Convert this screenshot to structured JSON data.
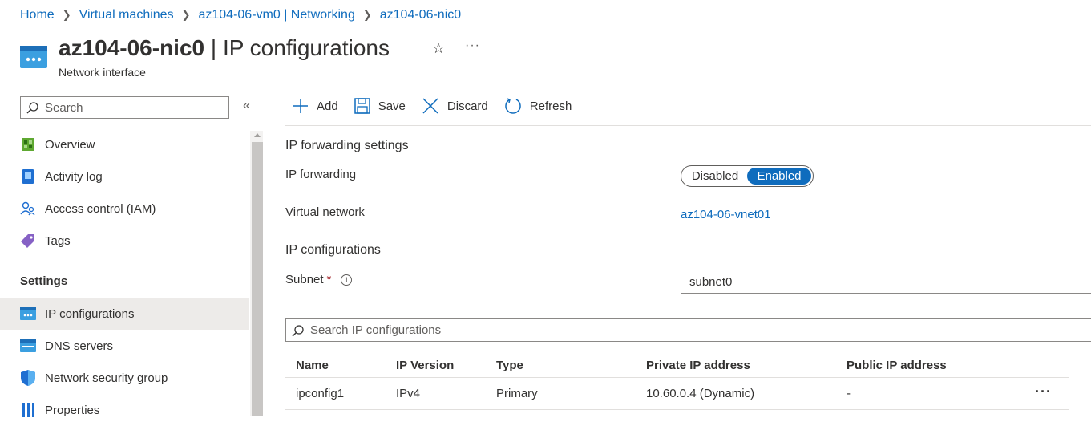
{
  "breadcrumb": [
    "Home",
    "Virtual machines",
    "az104-06-vm0 | Networking",
    "az104-06-nic0"
  ],
  "header": {
    "title_bold": "az104-06-nic0",
    "title_rest": " | IP configurations",
    "subtitle": "Network interface",
    "icons": [
      "network-interface-icon",
      "star-icon",
      "more-icon"
    ]
  },
  "sidebar": {
    "search_placeholder": "Search",
    "items_top": [
      {
        "label": "Overview",
        "icon": "overview-icon"
      },
      {
        "label": "Activity log",
        "icon": "activity-log-icon"
      },
      {
        "label": "Access control (IAM)",
        "icon": "iam-icon"
      },
      {
        "label": "Tags",
        "icon": "tag-icon"
      }
    ],
    "section": "Settings",
    "items_settings": [
      {
        "label": "IP configurations",
        "icon": "ip-config-icon",
        "active": true
      },
      {
        "label": "DNS servers",
        "icon": "dns-icon"
      },
      {
        "label": "Network security group",
        "icon": "nsg-shield-icon"
      },
      {
        "label": "Properties",
        "icon": "properties-icon"
      }
    ]
  },
  "toolbar": {
    "add": "Add",
    "save": "Save",
    "discard": "Discard",
    "refresh": "Refresh"
  },
  "ip_forwarding": {
    "heading": "IP forwarding settings",
    "label": "IP forwarding",
    "options": [
      "Disabled",
      "Enabled"
    ],
    "selected": "Enabled",
    "vnet_label": "Virtual network",
    "vnet_value": "az104-06-vnet01"
  },
  "ip_configurations": {
    "heading": "IP configurations",
    "subnet_label": "Subnet",
    "subnet_required": "*",
    "subnet_value": "subnet0",
    "search_placeholder": "Search IP configurations",
    "columns": [
      "Name",
      "IP Version",
      "Type",
      "Private IP address",
      "Public IP address"
    ],
    "rows": [
      {
        "name": "ipconfig1",
        "version": "IPv4",
        "type": "Primary",
        "private_ip": "10.60.0.4 (Dynamic)",
        "public_ip": "-"
      }
    ]
  },
  "colors": {
    "accent": "#0f6cbd",
    "active_bg": "#edebe9"
  }
}
